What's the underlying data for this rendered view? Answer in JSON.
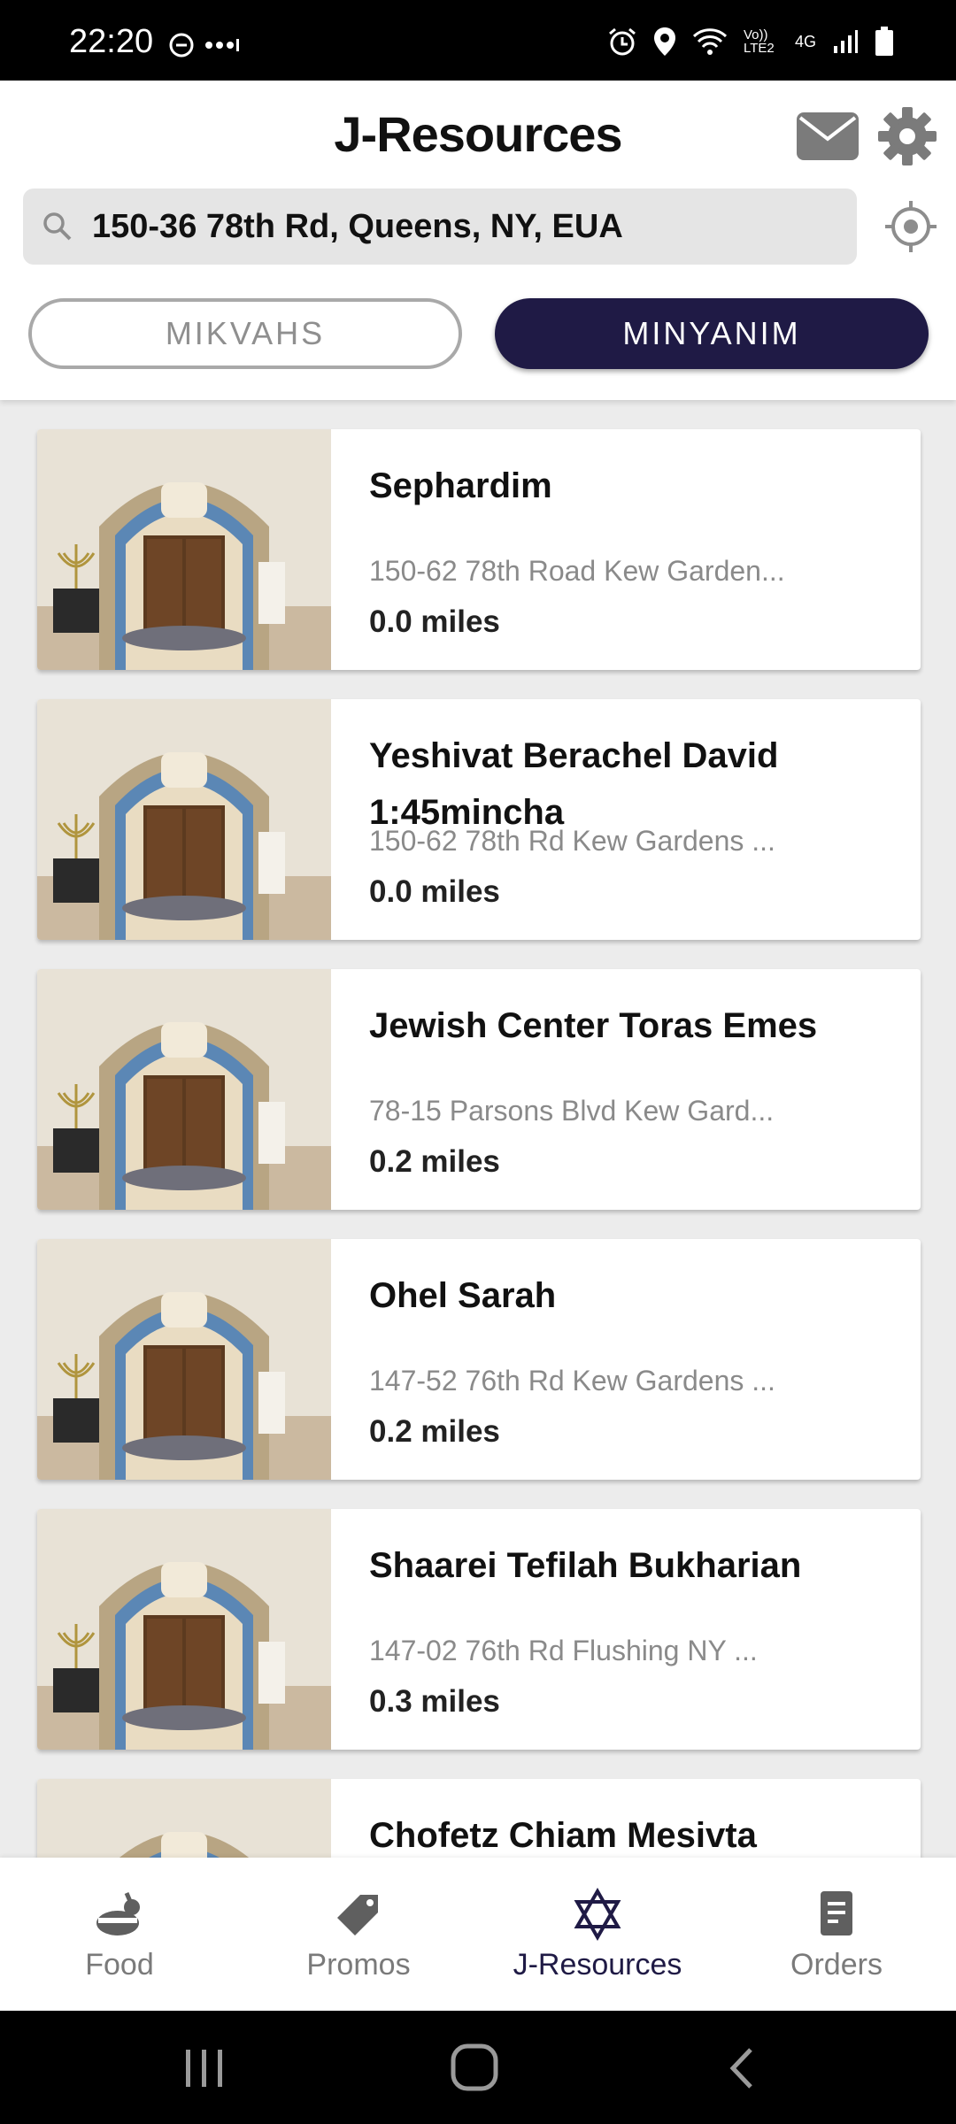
{
  "status_bar": {
    "time": "22:20",
    "network": "4G",
    "carrier": "Vo)) LTE2"
  },
  "header": {
    "title": "J-Resources"
  },
  "search": {
    "value": "150-36 78th Rd, Queens, NY, EUA"
  },
  "tabs": {
    "mikvahs": "MIKVAHS",
    "minyanim": "MINYANIM",
    "active": "minyanim"
  },
  "listings": [
    {
      "name": "Sephardim",
      "address": "150-62 78th Road Kew Garden...",
      "distance": "0.0 miles"
    },
    {
      "name": "Yeshivat Berachel David 1:45mincha",
      "address": "150-62 78th Rd Kew Gardens ...",
      "distance": "0.0 miles"
    },
    {
      "name": "Jewish Center Toras Emes",
      "address": "78-15 Parsons Blvd Kew Gard...",
      "distance": "0.2 miles"
    },
    {
      "name": "Ohel Sarah",
      "address": "147-52 76th Rd Kew Gardens ...",
      "distance": "0.2 miles"
    },
    {
      "name": "Shaarei Tefilah Bukharian",
      "address": "147-02 76th Rd Flushing NY ...",
      "distance": "0.3 miles"
    },
    {
      "name": "Chofetz Chiam Mesivta",
      "address": "",
      "distance": ""
    }
  ],
  "bottom_nav": [
    {
      "label": "Food",
      "icon": "food-icon"
    },
    {
      "label": "Promos",
      "icon": "tag-icon"
    },
    {
      "label": "J-Resources",
      "icon": "star-of-david-icon",
      "active": true
    },
    {
      "label": "Orders",
      "icon": "receipt-icon"
    }
  ],
  "colors": {
    "accent": "#1f1a45",
    "inactive": "#7a7a7a",
    "background": "#ececec"
  }
}
